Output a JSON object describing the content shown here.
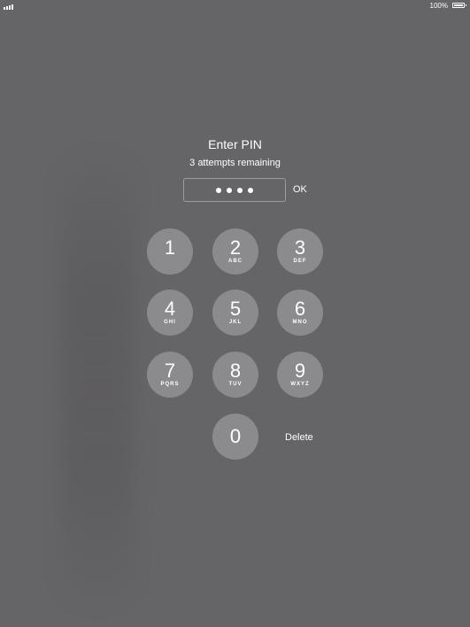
{
  "status_bar": {
    "signal_icon": "signal-bars-icon",
    "battery_percent": "100%",
    "battery_icon": "battery-full-icon"
  },
  "pin_prompt": {
    "title": "Enter PIN",
    "attempts_text": "3 attempts remaining",
    "entered_digits_count": 4,
    "ok_label": "OK"
  },
  "keypad": {
    "keys": [
      {
        "digit": "1",
        "letters": ""
      },
      {
        "digit": "2",
        "letters": "ABC"
      },
      {
        "digit": "3",
        "letters": "DEF"
      },
      {
        "digit": "4",
        "letters": "GHI"
      },
      {
        "digit": "5",
        "letters": "JKL"
      },
      {
        "digit": "6",
        "letters": "MNO"
      },
      {
        "digit": "7",
        "letters": "PQRS"
      },
      {
        "digit": "8",
        "letters": "TUV"
      },
      {
        "digit": "9",
        "letters": "WXYZ"
      },
      {
        "digit": "0",
        "letters": ""
      }
    ],
    "delete_label": "Delete"
  },
  "colors": {
    "background": "#656466",
    "key_fill": "#8b8a8d",
    "text": "#ffffff"
  }
}
